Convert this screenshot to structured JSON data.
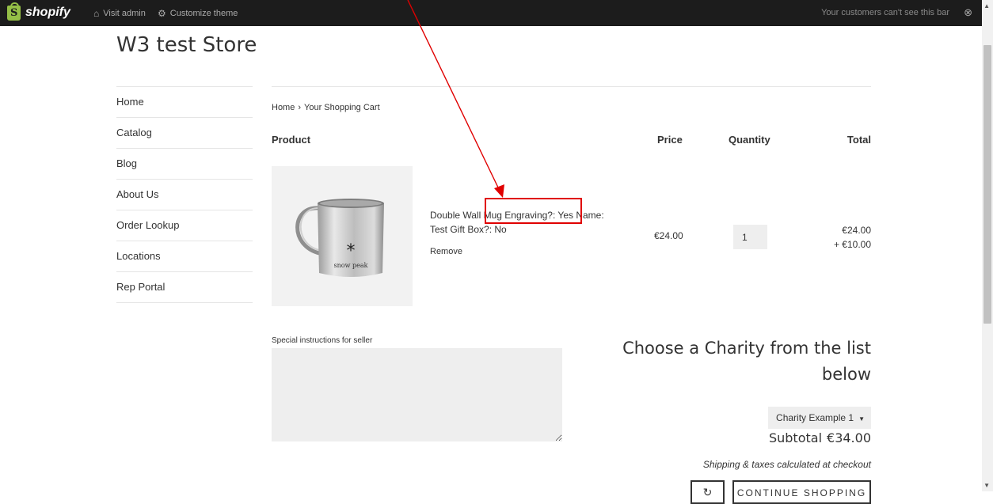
{
  "topbar": {
    "logo_text": "shopify",
    "visit_admin": "Visit admin",
    "customize_theme": "Customize theme",
    "notice": "Your customers can't see this bar"
  },
  "store": {
    "title": "W3 test Store"
  },
  "nav": {
    "items": [
      "Home",
      "Catalog",
      "Blog",
      "About Us",
      "Order Lookup",
      "Locations",
      "Rep Portal"
    ]
  },
  "breadcrumb": {
    "home": "Home",
    "separator": "›",
    "current": "Your Shopping Cart"
  },
  "cart": {
    "headers": {
      "product": "Product",
      "price": "Price",
      "quantity": "Quantity",
      "total": "Total"
    },
    "item": {
      "name_line1": "Double Wall Mug Engraving?: Yes Name:",
      "name_line2": "Test Gift Box?: No",
      "remove": "Remove",
      "price": "€24.00",
      "quantity": "1",
      "total": "€24.00",
      "total_extra": "+ €10.00",
      "image_brand": "snow peak"
    }
  },
  "notes": {
    "label": "Special instructions for seller",
    "value": ""
  },
  "charity": {
    "heading": "Choose a Charity from the list below",
    "selected": "Charity Example 1"
  },
  "summary": {
    "subtotal_label": "Subtotal",
    "subtotal_value": "€34.00",
    "shipping_note": "Shipping & taxes calculated at checkout"
  },
  "buttons": {
    "continue": "CONTINUE SHOPPING"
  },
  "colors": {
    "annotation": "#e00000",
    "topbar": "#1c1c1c",
    "shopify_green": "#95bf47"
  },
  "icons": {
    "home": "home-icon",
    "gear": "gear-icon",
    "refresh": "refresh-icon"
  }
}
